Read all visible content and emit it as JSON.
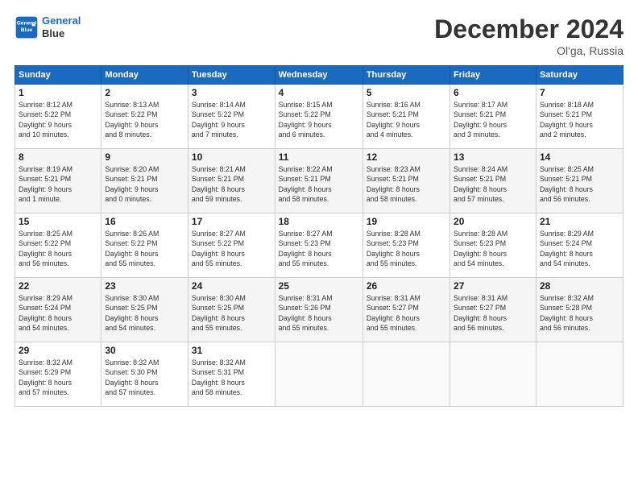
{
  "header": {
    "logo_line1": "General",
    "logo_line2": "Blue",
    "month_title": "December 2024",
    "location": "Ol'ga, Russia"
  },
  "weekdays": [
    "Sunday",
    "Monday",
    "Tuesday",
    "Wednesday",
    "Thursday",
    "Friday",
    "Saturday"
  ],
  "weeks": [
    [
      {
        "day": "1",
        "info": "Sunrise: 8:12 AM\nSunset: 5:22 PM\nDaylight: 9 hours\nand 10 minutes."
      },
      {
        "day": "2",
        "info": "Sunrise: 8:13 AM\nSunset: 5:22 PM\nDaylight: 9 hours\nand 8 minutes."
      },
      {
        "day": "3",
        "info": "Sunrise: 8:14 AM\nSunset: 5:22 PM\nDaylight: 9 hours\nand 7 minutes."
      },
      {
        "day": "4",
        "info": "Sunrise: 8:15 AM\nSunset: 5:22 PM\nDaylight: 9 hours\nand 6 minutes."
      },
      {
        "day": "5",
        "info": "Sunrise: 8:16 AM\nSunset: 5:21 PM\nDaylight: 9 hours\nand 4 minutes."
      },
      {
        "day": "6",
        "info": "Sunrise: 8:17 AM\nSunset: 5:21 PM\nDaylight: 9 hours\nand 3 minutes."
      },
      {
        "day": "7",
        "info": "Sunrise: 8:18 AM\nSunset: 5:21 PM\nDaylight: 9 hours\nand 2 minutes."
      }
    ],
    [
      {
        "day": "8",
        "info": "Sunrise: 8:19 AM\nSunset: 5:21 PM\nDaylight: 9 hours\nand 1 minute."
      },
      {
        "day": "9",
        "info": "Sunrise: 8:20 AM\nSunset: 5:21 PM\nDaylight: 9 hours\nand 0 minutes."
      },
      {
        "day": "10",
        "info": "Sunrise: 8:21 AM\nSunset: 5:21 PM\nDaylight: 8 hours\nand 59 minutes."
      },
      {
        "day": "11",
        "info": "Sunrise: 8:22 AM\nSunset: 5:21 PM\nDaylight: 8 hours\nand 58 minutes."
      },
      {
        "day": "12",
        "info": "Sunrise: 8:23 AM\nSunset: 5:21 PM\nDaylight: 8 hours\nand 58 minutes."
      },
      {
        "day": "13",
        "info": "Sunrise: 8:24 AM\nSunset: 5:21 PM\nDaylight: 8 hours\nand 57 minutes."
      },
      {
        "day": "14",
        "info": "Sunrise: 8:25 AM\nSunset: 5:21 PM\nDaylight: 8 hours\nand 56 minutes."
      }
    ],
    [
      {
        "day": "15",
        "info": "Sunrise: 8:25 AM\nSunset: 5:22 PM\nDaylight: 8 hours\nand 56 minutes."
      },
      {
        "day": "16",
        "info": "Sunrise: 8:26 AM\nSunset: 5:22 PM\nDaylight: 8 hours\nand 55 minutes."
      },
      {
        "day": "17",
        "info": "Sunrise: 8:27 AM\nSunset: 5:22 PM\nDaylight: 8 hours\nand 55 minutes."
      },
      {
        "day": "18",
        "info": "Sunrise: 8:27 AM\nSunset: 5:23 PM\nDaylight: 8 hours\nand 55 minutes."
      },
      {
        "day": "19",
        "info": "Sunrise: 8:28 AM\nSunset: 5:23 PM\nDaylight: 8 hours\nand 55 minutes."
      },
      {
        "day": "20",
        "info": "Sunrise: 8:28 AM\nSunset: 5:23 PM\nDaylight: 8 hours\nand 54 minutes."
      },
      {
        "day": "21",
        "info": "Sunrise: 8:29 AM\nSunset: 5:24 PM\nDaylight: 8 hours\nand 54 minutes."
      }
    ],
    [
      {
        "day": "22",
        "info": "Sunrise: 8:29 AM\nSunset: 5:24 PM\nDaylight: 8 hours\nand 54 minutes."
      },
      {
        "day": "23",
        "info": "Sunrise: 8:30 AM\nSunset: 5:25 PM\nDaylight: 8 hours\nand 54 minutes."
      },
      {
        "day": "24",
        "info": "Sunrise: 8:30 AM\nSunset: 5:25 PM\nDaylight: 8 hours\nand 55 minutes."
      },
      {
        "day": "25",
        "info": "Sunrise: 8:31 AM\nSunset: 5:26 PM\nDaylight: 8 hours\nand 55 minutes."
      },
      {
        "day": "26",
        "info": "Sunrise: 8:31 AM\nSunset: 5:27 PM\nDaylight: 8 hours\nand 55 minutes."
      },
      {
        "day": "27",
        "info": "Sunrise: 8:31 AM\nSunset: 5:27 PM\nDaylight: 8 hours\nand 56 minutes."
      },
      {
        "day": "28",
        "info": "Sunrise: 8:32 AM\nSunset: 5:28 PM\nDaylight: 8 hours\nand 56 minutes."
      }
    ],
    [
      {
        "day": "29",
        "info": "Sunrise: 8:32 AM\nSunset: 5:29 PM\nDaylight: 8 hours\nand 57 minutes."
      },
      {
        "day": "30",
        "info": "Sunrise: 8:32 AM\nSunset: 5:30 PM\nDaylight: 8 hours\nand 57 minutes."
      },
      {
        "day": "31",
        "info": "Sunrise: 8:32 AM\nSunset: 5:31 PM\nDaylight: 8 hours\nand 58 minutes."
      },
      null,
      null,
      null,
      null
    ]
  ]
}
